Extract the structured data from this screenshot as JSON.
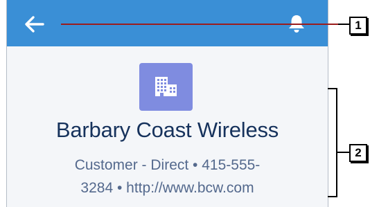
{
  "navbar": {
    "back_icon": "arrow-left-icon",
    "notifications_icon": "bell-icon",
    "background_color": "#3a8fd6"
  },
  "record": {
    "icon": "building-icon",
    "icon_color": "#7f8ce0",
    "name": "Barbary Coast Wireless",
    "details_line1": "Customer - Direct • 415-555-",
    "details_line2_phone_end": "3284",
    "separator": " • ",
    "website": "http://www.bcw.com"
  },
  "callouts": {
    "badge_1": "1",
    "badge_2": "2"
  }
}
